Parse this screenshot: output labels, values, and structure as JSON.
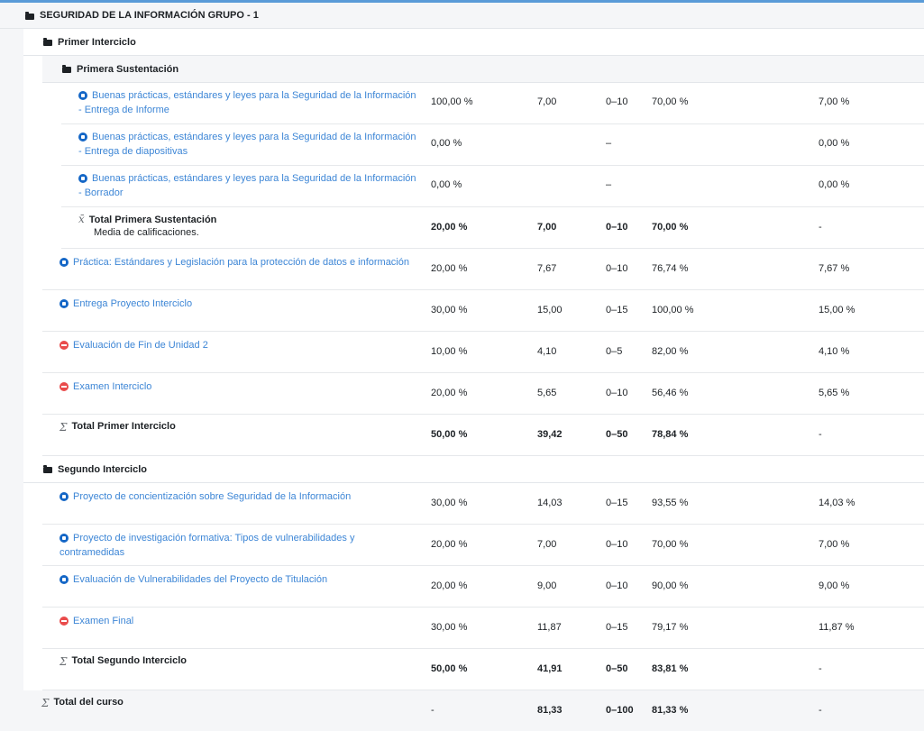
{
  "course": {
    "title": "SEGURIDAD DE LA INFORMACIÓN GRUPO - 1"
  },
  "primer": {
    "title": "Primer Interciclo",
    "sust": {
      "title": "Primera Sustentación",
      "items": [
        {
          "l1": "Buenas prácticas, estándares y leyes para la Seguridad de la Información",
          "l2": "- Entrega de Informe",
          "w": "100,00 %",
          "g": "7,00",
          "r": "0–10",
          "p": "70,00 %",
          "c": "7,00 %"
        },
        {
          "l1": "Buenas prácticas, estándares y leyes para la Seguridad de la Información",
          "l2": "- Entrega de diapositivas",
          "w": "0,00 %",
          "g": "",
          "r": "–",
          "p": "",
          "c": "0,00 %"
        },
        {
          "l1": "Buenas prácticas, estándares y leyes para la Seguridad de la Información",
          "l2": "- Borrador",
          "w": "0,00 %",
          "g": "",
          "r": "–",
          "p": "",
          "c": "0,00 %"
        }
      ],
      "total": {
        "label": "Total Primera Sustentación",
        "sub": "Media de calificaciones.",
        "w": "20,00 %",
        "g": "7,00",
        "r": "0–10",
        "p": "70,00 %",
        "c": "-"
      }
    },
    "items": [
      {
        "label": "Práctica: Estándares y Legislación para la protección de datos e información",
        "icon": "assignment-icon",
        "w": "20,00 %",
        "g": "7,67",
        "r": "0–10",
        "p": "76,74 %",
        "c": "7,67 %"
      },
      {
        "label": "Entrega Proyecto Interciclo",
        "icon": "assignment-icon",
        "w": "30,00 %",
        "g": "15,00",
        "r": "0–15",
        "p": "100,00 %",
        "c": "15,00 %"
      },
      {
        "label": "Evaluación de Fin de Unidad 2",
        "icon": "quiz-icon",
        "w": "10,00 %",
        "g": "4,10",
        "r": "0–5",
        "p": "82,00 %",
        "c": "4,10 %"
      },
      {
        "label": "Examen Interciclo",
        "icon": "quiz-icon",
        "w": "20,00 %",
        "g": "5,65",
        "r": "0–10",
        "p": "56,46 %",
        "c": "5,65 %"
      }
    ],
    "total": {
      "label": "Total Primer Interciclo",
      "w": "50,00 %",
      "g": "39,42",
      "r": "0–50",
      "p": "78,84 %",
      "c": "-"
    }
  },
  "segundo": {
    "title": "Segundo Interciclo",
    "items": [
      {
        "l1": "Proyecto de concientización sobre Seguridad de la Información",
        "l2": "",
        "icon": "assignment-icon",
        "w": "30,00 %",
        "g": "14,03",
        "r": "0–15",
        "p": "93,55 %",
        "c": "14,03 %"
      },
      {
        "l1": "Proyecto de investigación formativa: Tipos de vulnerabilidades y",
        "l2": "contramedidas",
        "icon": "assignment-icon",
        "w": "20,00 %",
        "g": "7,00",
        "r": "0–10",
        "p": "70,00 %",
        "c": "7,00 %"
      },
      {
        "l1": "Evaluación de Vulnerabilidades del Proyecto de Titulación",
        "l2": "",
        "icon": "assignment-icon",
        "w": "20,00 %",
        "g": "9,00",
        "r": "0–10",
        "p": "90,00 %",
        "c": "9,00 %"
      },
      {
        "l1": "Examen Final",
        "l2": "",
        "icon": "quiz-icon",
        "w": "30,00 %",
        "g": "11,87",
        "r": "0–15",
        "p": "79,17 %",
        "c": "11,87 %"
      }
    ],
    "total": {
      "label": "Total Segundo Interciclo",
      "w": "50,00 %",
      "g": "41,91",
      "r": "0–50",
      "p": "83,81 %",
      "c": "-"
    }
  },
  "curso_total": {
    "label": "Total del curso",
    "w": "-",
    "g": "81,33",
    "r": "0–100",
    "p": "81,33 %",
    "c": "-"
  },
  "icons": {
    "folder": "folder-icon",
    "sigma": "Σ",
    "calc": "x̄"
  },
  "colors": {
    "link": "#3d86d6",
    "assignment": "#1466c6",
    "quiz": "#e94b4b",
    "topline": "#5a9bd8"
  }
}
